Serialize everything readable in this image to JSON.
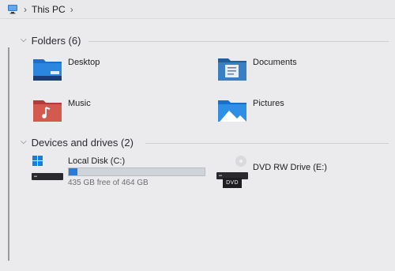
{
  "breadcrumb": {
    "current": "This PC"
  },
  "folders": {
    "header": "Folders (6)",
    "items": [
      {
        "label": "Desktop",
        "icon": "desktop-folder-icon"
      },
      {
        "label": "Documents",
        "icon": "documents-folder-icon"
      },
      {
        "label": "Music",
        "icon": "music-folder-icon"
      },
      {
        "label": "Pictures",
        "icon": "pictures-folder-icon"
      }
    ]
  },
  "drives": {
    "header": "Devices and drives (2)",
    "items": [
      {
        "label": "Local Disk (C:)",
        "free_text": "435 GB free of 464 GB",
        "used_fraction": 0.0625,
        "icon": "windows-drive-icon"
      },
      {
        "label": "DVD RW Drive (E:)",
        "badge": "DVD",
        "icon": "dvd-drive-icon"
      }
    ]
  },
  "colors": {
    "accent": "#2a7ad6",
    "folder": "#2b7fd4"
  }
}
